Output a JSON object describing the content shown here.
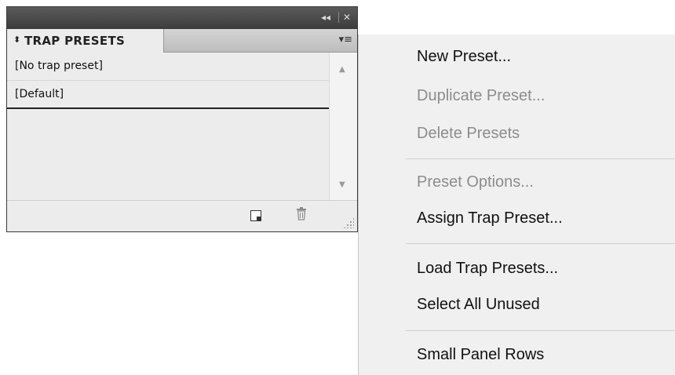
{
  "panel": {
    "tab_title": "TRAP PRESETS",
    "collapse_glyph": "◂◂",
    "close_glyph": "✕",
    "tab_arrows_glyph": "⬍",
    "menu_glyph": "▾≡",
    "presets": [
      {
        "label": "[No trap preset]"
      },
      {
        "label": "[Default]"
      }
    ]
  },
  "menu": {
    "items": [
      {
        "label": "New Preset...",
        "enabled": true
      },
      {
        "label": "Duplicate Preset...",
        "enabled": false
      },
      {
        "label": "Delete Presets",
        "enabled": false
      },
      {
        "label": "Preset Options...",
        "enabled": false
      },
      {
        "label": "Assign Trap Preset...",
        "enabled": true
      },
      {
        "label": "Load Trap Presets...",
        "enabled": true
      },
      {
        "label": "Select All Unused",
        "enabled": true
      },
      {
        "label": "Small Panel Rows",
        "enabled": true
      }
    ]
  },
  "colors": {
    "titlebar": "#3c3c3c",
    "panel_bg": "#ececec",
    "menu_bg": "#f0f0f0",
    "enabled_text": "#111111",
    "disabled_text": "#8c8c8c"
  }
}
